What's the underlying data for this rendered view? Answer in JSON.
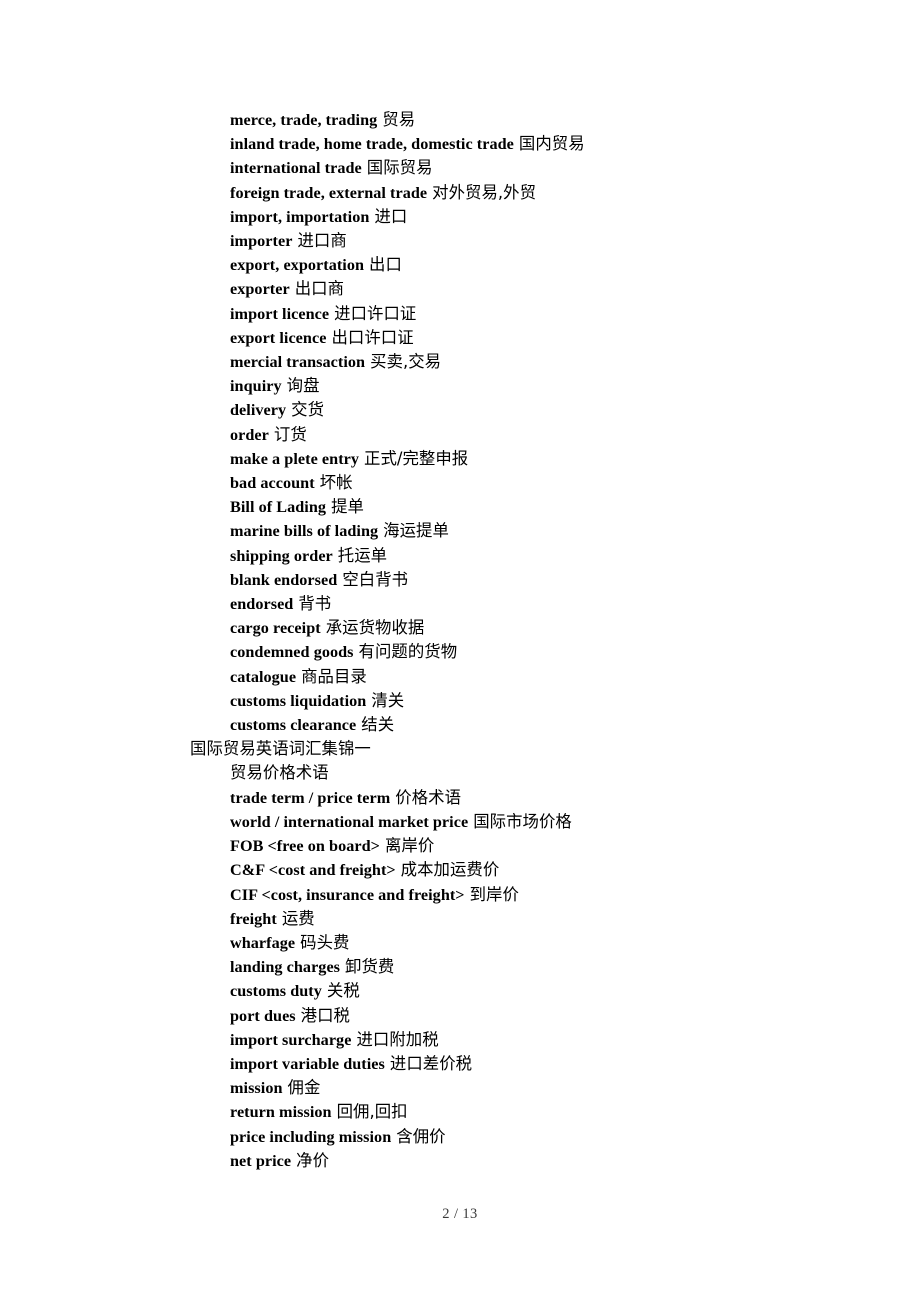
{
  "document": {
    "background_color": "#ffffff",
    "text_color": "#000000",
    "footer": {
      "page_number": "2",
      "separator": "/",
      "total_pages": "13",
      "text": "2 / 13",
      "color": "#3a3a3a"
    }
  },
  "lines": [
    {
      "type": "entry",
      "term": "merce, trade, trading",
      "gloss": "贸易"
    },
    {
      "type": "entry",
      "term": "inland trade, home trade, domestic trade",
      "gloss": "国内贸易"
    },
    {
      "type": "entry",
      "term": "international trade",
      "gloss": "国际贸易"
    },
    {
      "type": "entry",
      "term": "foreign trade, external trade",
      "gloss": "对外贸易,外贸"
    },
    {
      "type": "entry",
      "term": "import, importation",
      "gloss": "进口"
    },
    {
      "type": "entry",
      "term": "importer",
      "gloss": "进口商"
    },
    {
      "type": "entry",
      "term": "export, exportation",
      "gloss": "出口"
    },
    {
      "type": "entry",
      "term": "exporter",
      "gloss": "出口商"
    },
    {
      "type": "entry",
      "term": "import licence",
      "gloss": "进口许口证"
    },
    {
      "type": "entry",
      "term": "export licence",
      "gloss": "出口许口证"
    },
    {
      "type": "entry",
      "term": "mercial transaction",
      "gloss": "买卖,交易"
    },
    {
      "type": "entry",
      "term": "inquiry",
      "gloss": "询盘"
    },
    {
      "type": "entry",
      "term": "delivery",
      "gloss": "交货"
    },
    {
      "type": "entry",
      "term": "order",
      "gloss": "订货"
    },
    {
      "type": "entry",
      "term": "make a plete entry",
      "gloss": "正式/完整申报"
    },
    {
      "type": "entry",
      "term": "bad account",
      "gloss": "坏帐"
    },
    {
      "type": "entry",
      "term": "Bill of Lading",
      "gloss": "提单"
    },
    {
      "type": "entry",
      "term": "marine bills of lading",
      "gloss": "海运提单"
    },
    {
      "type": "entry",
      "term": "shipping order",
      "gloss": "托运单"
    },
    {
      "type": "entry",
      "term": "blank endorsed",
      "gloss": "空白背书"
    },
    {
      "type": "entry",
      "term": "endorsed",
      "gloss": "背书"
    },
    {
      "type": "entry",
      "term": "cargo receipt",
      "gloss": "承运货物收据"
    },
    {
      "type": "entry",
      "term": "condemned goods",
      "gloss": "有问题的货物"
    },
    {
      "type": "entry",
      "term": "catalogue",
      "gloss": "商品目录"
    },
    {
      "type": "entry",
      "term": "customs liquidation",
      "gloss": "清关"
    },
    {
      "type": "entry",
      "term": "customs clearance",
      "gloss": "结关"
    },
    {
      "type": "section-heading",
      "term": "",
      "gloss": "国际贸易英语词汇集锦一"
    },
    {
      "type": "sub-heading",
      "term": "",
      "gloss": "贸易价格术语"
    },
    {
      "type": "entry",
      "term": "trade term / price term",
      "gloss": "价格术语"
    },
    {
      "type": "entry",
      "term": "world / international market price",
      "gloss": "国际市场价格"
    },
    {
      "type": "entry",
      "term": "FOB <free on board>",
      "gloss": "离岸价"
    },
    {
      "type": "entry",
      "term": "C&F <cost and freight>",
      "gloss": "成本加运费价"
    },
    {
      "type": "entry",
      "term": "CIF <cost, insurance and freight>",
      "gloss": "到岸价"
    },
    {
      "type": "entry",
      "term": "freight",
      "gloss": "运费"
    },
    {
      "type": "entry",
      "term": "wharfage",
      "gloss": "码头费"
    },
    {
      "type": "entry",
      "term": "landing charges",
      "gloss": "卸货费"
    },
    {
      "type": "entry",
      "term": "customs duty",
      "gloss": "关税"
    },
    {
      "type": "entry",
      "term": "port dues",
      "gloss": "港口税"
    },
    {
      "type": "entry",
      "term": "import surcharge",
      "gloss": "进口附加税"
    },
    {
      "type": "entry",
      "term": "import variable duties",
      "gloss": "进口差价税"
    },
    {
      "type": "entry",
      "term": "mission",
      "gloss": "佣金"
    },
    {
      "type": "entry",
      "term": "return mission",
      "gloss": "回佣,回扣"
    },
    {
      "type": "entry",
      "term": "price including mission",
      "gloss": "含佣价"
    },
    {
      "type": "entry",
      "term": "net price",
      "gloss": "净价"
    }
  ]
}
